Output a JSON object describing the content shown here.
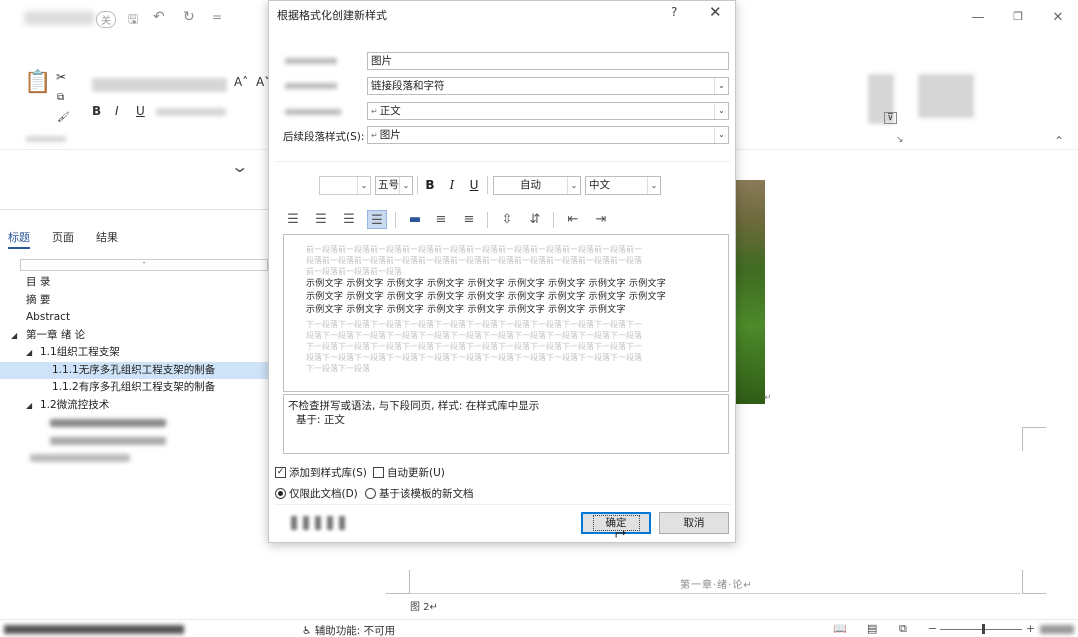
{
  "dialog": {
    "title": "根据格式化创建新样式",
    "help_icon": "?",
    "close_icon": "✕",
    "name_value": "图片",
    "style_type_value": "链接段落和字符",
    "style_based_on_value": "正文",
    "next_style_label": "后续段落样式(S):",
    "next_style_value": "图片",
    "font_size_value": "五号",
    "bold": "B",
    "italic": "I",
    "underline": "U",
    "color_value": "自动",
    "script_value": "中文",
    "preview_prev_lines": [
      "前一段落前一段落前一段落前一段落前一段落前一段落前一段落前一段落前一段落前一段落前一",
      "段落前一段落前一段落前一段落前一段落前一段落前一段落前一段落前一段落前一段落前一段落",
      "前一段落前一段落前一段落"
    ],
    "preview_sample_lines": [
      "示例文字 示例文字 示例文字 示例文字 示例文字 示例文字 示例文字 示例文字 示例文字",
      "示例文字 示例文字 示例文字 示例文字 示例文字 示例文字 示例文字 示例文字 示例文字",
      "示例文字 示例文字 示例文字 示例文字 示例文字 示例文字 示例文字 示例文字"
    ],
    "preview_next_lines": [
      "下一段落下一段落下一段落下一段落下一段落下一段落下一段落下一段落下一段落下一段落下一",
      "段落下一段落下一段落下一段落下一段落下一段落下一段落下一段落下一段落下一段落下一段落",
      "下一段落下一段落下一段落下一段落下一段落下一段落下一段落下一段落下一段落下一段落下一",
      "段落下一段落下一段落下一段落下一段落下一段落下一段落下一段落下一段落下一段落下一段落",
      "下一段落下一段落"
    ],
    "description_line1": "不检查拼写或语法, 与下段同页, 样式: 在样式库中显示",
    "description_line2": "基于: 正文",
    "add_to_gallery_label": "添加到样式库(S)",
    "add_to_gallery_checked": true,
    "auto_update_label": "自动更新(U)",
    "auto_update_checked": false,
    "only_this_doc_label": "仅限此文档(D)",
    "new_docs_label": "基于该模板的新文档",
    "ok_label": "确定",
    "cancel_label": "取消"
  },
  "navigation": {
    "tabs": [
      "标题",
      "页面",
      "结果"
    ],
    "active_tab": "标题",
    "items": [
      {
        "text": "目 录",
        "level": 0
      },
      {
        "text": "摘 要",
        "level": 0
      },
      {
        "text": "Abstract",
        "level": 0
      },
      {
        "text": "第一章 绪 论",
        "level": 0,
        "expanded": true
      },
      {
        "text": "1.1组织工程支架",
        "level": 1,
        "expanded": true
      },
      {
        "text": "1.1.1无序多孔组织工程支架的制备",
        "level": 2,
        "selected": true
      },
      {
        "text": "1.1.2有序多孔组织工程支架的制备",
        "level": 2
      },
      {
        "text": "1.2微流控技术",
        "level": 1,
        "expanded": true
      }
    ]
  },
  "ribbon": {
    "font_grow": "A˄",
    "font_shrink": "A˅",
    "bold": "B",
    "italic": "I",
    "underline": "U"
  },
  "document": {
    "header_text": "第一章·绪·论↵",
    "figure_label": "图 2↵"
  },
  "statusbar": {
    "accessibility": "辅助功能: 不可用"
  },
  "colors": {
    "accent": "#0078d7",
    "selection": "#cfe3f8",
    "nav_active": "#2b579a"
  }
}
